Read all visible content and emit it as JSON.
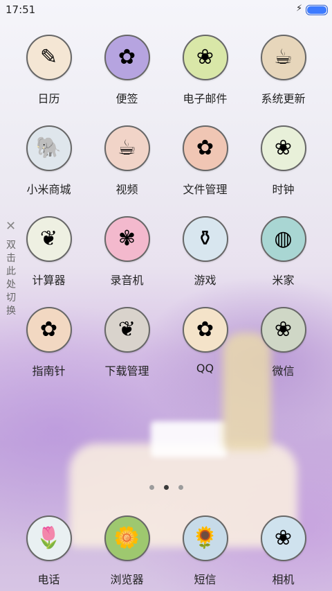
{
  "status_bar": {
    "time": "17:51"
  },
  "apps": [
    {
      "label": "日历",
      "icon": "photo-thumbnail-icon",
      "bg": "#f4e6d4",
      "glyph": "✎"
    },
    {
      "label": "便签",
      "icon": "lavender-icon",
      "bg": "#b6a4e0",
      "glyph": "✿"
    },
    {
      "label": "电子邮件",
      "icon": "grass-icon",
      "bg": "#d9e7a8",
      "glyph": "❀"
    },
    {
      "label": "系统更新",
      "icon": "teacup-icon",
      "bg": "#e7d6bb",
      "glyph": "☕"
    },
    {
      "label": "小米商城",
      "icon": "elephant-icon",
      "bg": "#dfe6ec",
      "glyph": "🐘"
    },
    {
      "label": "视频",
      "icon": "striped-cup-icon",
      "bg": "#f1d4c8",
      "glyph": "☕"
    },
    {
      "label": "文件管理",
      "icon": "rose-icon",
      "bg": "#f0c6b4",
      "glyph": "✿"
    },
    {
      "label": "时钟",
      "icon": "white-flowers-icon",
      "bg": "#e8f0d9",
      "glyph": "❀"
    },
    {
      "label": "计算器",
      "icon": "window-plant-icon",
      "bg": "#eef0e2",
      "glyph": "❦"
    },
    {
      "label": "录音机",
      "icon": "pink-hydrangea-icon",
      "bg": "#f3b9cd",
      "glyph": "✾"
    },
    {
      "label": "游戏",
      "icon": "glass-vase-icon",
      "bg": "#d8e6ef",
      "glyph": "⚱"
    },
    {
      "label": "米家",
      "icon": "teal-bottles-icon",
      "bg": "#a9d6d3",
      "glyph": "◍"
    },
    {
      "label": "指南针",
      "icon": "cake-icon",
      "bg": "#f2d8c2",
      "glyph": "✿"
    },
    {
      "label": "下载管理",
      "icon": "keepsake-box-icon",
      "bg": "#d9d3cc",
      "glyph": "❦"
    },
    {
      "label": "QQ",
      "icon": "peach-flower-icon",
      "bg": "#f4e3c9",
      "glyph": "✿"
    },
    {
      "label": "微信",
      "icon": "wildflowers-icon",
      "bg": "#cfd7c6",
      "glyph": "❀"
    }
  ],
  "side_hint": {
    "close_glyph": "✕",
    "text": "双击此处切换"
  },
  "page_indicator": {
    "count": 3,
    "active": 2
  },
  "dock": [
    {
      "label": "电话",
      "icon": "tulip-icon",
      "bg": "#e9f0f2",
      "glyph": "🌷"
    },
    {
      "label": "浏览器",
      "icon": "daisy-icon",
      "bg": "#9ec86f",
      "glyph": "🌼"
    },
    {
      "label": "短信",
      "icon": "sunflower-icon",
      "bg": "#c7dbe9",
      "glyph": "🌻"
    },
    {
      "label": "相机",
      "icon": "yellow-flowers-icon",
      "bg": "#cfe2ee",
      "glyph": "❀"
    }
  ]
}
